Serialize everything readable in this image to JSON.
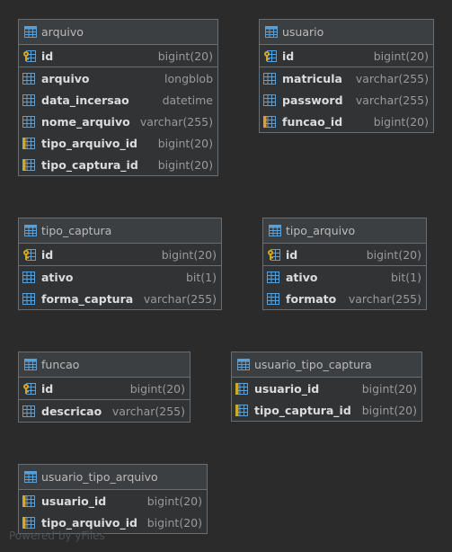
{
  "entities": [
    {
      "key": "arquivo",
      "name": "arquivo",
      "pk": [
        {
          "name": "id",
          "type": "bigint(20)"
        }
      ],
      "cols": [
        {
          "name": "arquivo",
          "type": "longblob",
          "kind": "col"
        },
        {
          "name": "data_incersao",
          "type": "datetime",
          "kind": "col"
        },
        {
          "name": "nome_arquivo",
          "type": "varchar(255)",
          "kind": "col"
        },
        {
          "name": "tipo_arquivo_id",
          "type": "bigint(20)",
          "kind": "fk"
        },
        {
          "name": "tipo_captura_id",
          "type": "bigint(20)",
          "kind": "fk"
        }
      ]
    },
    {
      "key": "usuario",
      "name": "usuario",
      "pk": [
        {
          "name": "id",
          "type": "bigint(20)"
        }
      ],
      "cols": [
        {
          "name": "matricula",
          "type": "varchar(255)",
          "kind": "col"
        },
        {
          "name": "password",
          "type": "varchar(255)",
          "kind": "col"
        },
        {
          "name": "funcao_id",
          "type": "bigint(20)",
          "kind": "fk"
        }
      ]
    },
    {
      "key": "tipo_captura",
      "name": "tipo_captura",
      "pk": [
        {
          "name": "id",
          "type": "bigint(20)"
        }
      ],
      "cols": [
        {
          "name": "ativo",
          "type": "bit(1)",
          "kind": "col"
        },
        {
          "name": "forma_captura",
          "type": "varchar(255)",
          "kind": "col"
        }
      ]
    },
    {
      "key": "tipo_arquivo",
      "name": "tipo_arquivo",
      "pk": [
        {
          "name": "id",
          "type": "bigint(20)"
        }
      ],
      "cols": [
        {
          "name": "ativo",
          "type": "bit(1)",
          "kind": "col"
        },
        {
          "name": "formato",
          "type": "varchar(255)",
          "kind": "col"
        }
      ]
    },
    {
      "key": "funcao",
      "name": "funcao",
      "pk": [
        {
          "name": "id",
          "type": "bigint(20)"
        }
      ],
      "cols": [
        {
          "name": "descricao",
          "type": "varchar(255)",
          "kind": "col"
        }
      ]
    },
    {
      "key": "usuario_tipo_captura",
      "name": "usuario_tipo_captura",
      "pk": [
        {
          "name": "usuario_id",
          "type": "bigint(20)",
          "kind": "fk"
        },
        {
          "name": "tipo_captura_id",
          "type": "bigint(20)",
          "kind": "fk"
        }
      ],
      "cols": []
    },
    {
      "key": "usuario_tipo_arquivo",
      "name": "usuario_tipo_arquivo",
      "pk": [
        {
          "name": "usuario_id",
          "type": "bigint(20)",
          "kind": "fk"
        },
        {
          "name": "tipo_arquivo_id",
          "type": "bigint(20)",
          "kind": "fk"
        }
      ],
      "cols": []
    }
  ],
  "watermark": "Powered by yFiles",
  "colors": {
    "background": "#2b2b2b",
    "header": "#3c3f41",
    "body": "#313335",
    "border": "#6b6e70",
    "table_icon": "#5aa0d8",
    "key_icon": "#d7a42a"
  }
}
